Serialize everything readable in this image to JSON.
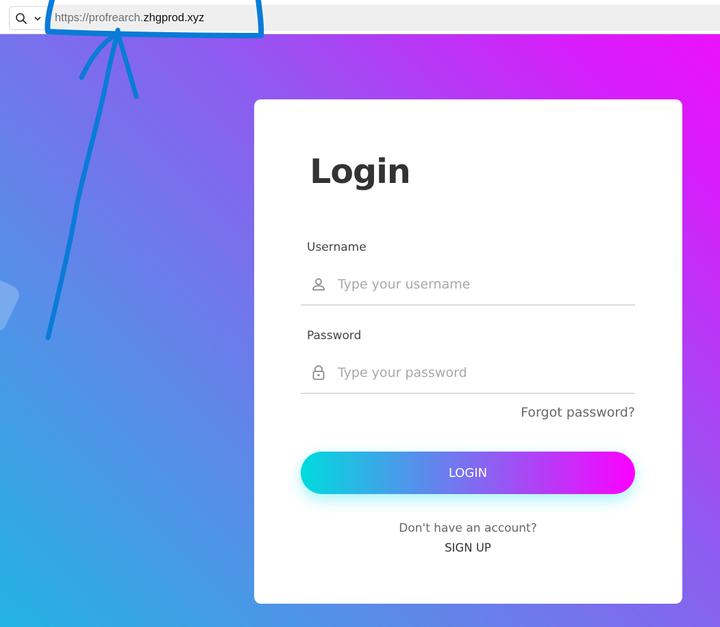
{
  "browser": {
    "url_scheme": "https://profrearch.",
    "url_domain": "zhgprod.xyz",
    "search_icon": "search-icon",
    "dropdown_icon": "chevron-down-icon"
  },
  "login": {
    "title": "Login",
    "username_label": "Username",
    "username_placeholder": "Type your username",
    "password_label": "Password",
    "password_placeholder": "Type your password",
    "forgot_password": "Forgot password?",
    "login_button": "LOGIN",
    "no_account_text": "Don't have an account?",
    "signup_link": "SIGN UP"
  },
  "colors": {
    "annotation": "#0a7bd8",
    "gradient_start": "#00dbde",
    "gradient_end": "#fc00ff",
    "title": "#333333"
  }
}
